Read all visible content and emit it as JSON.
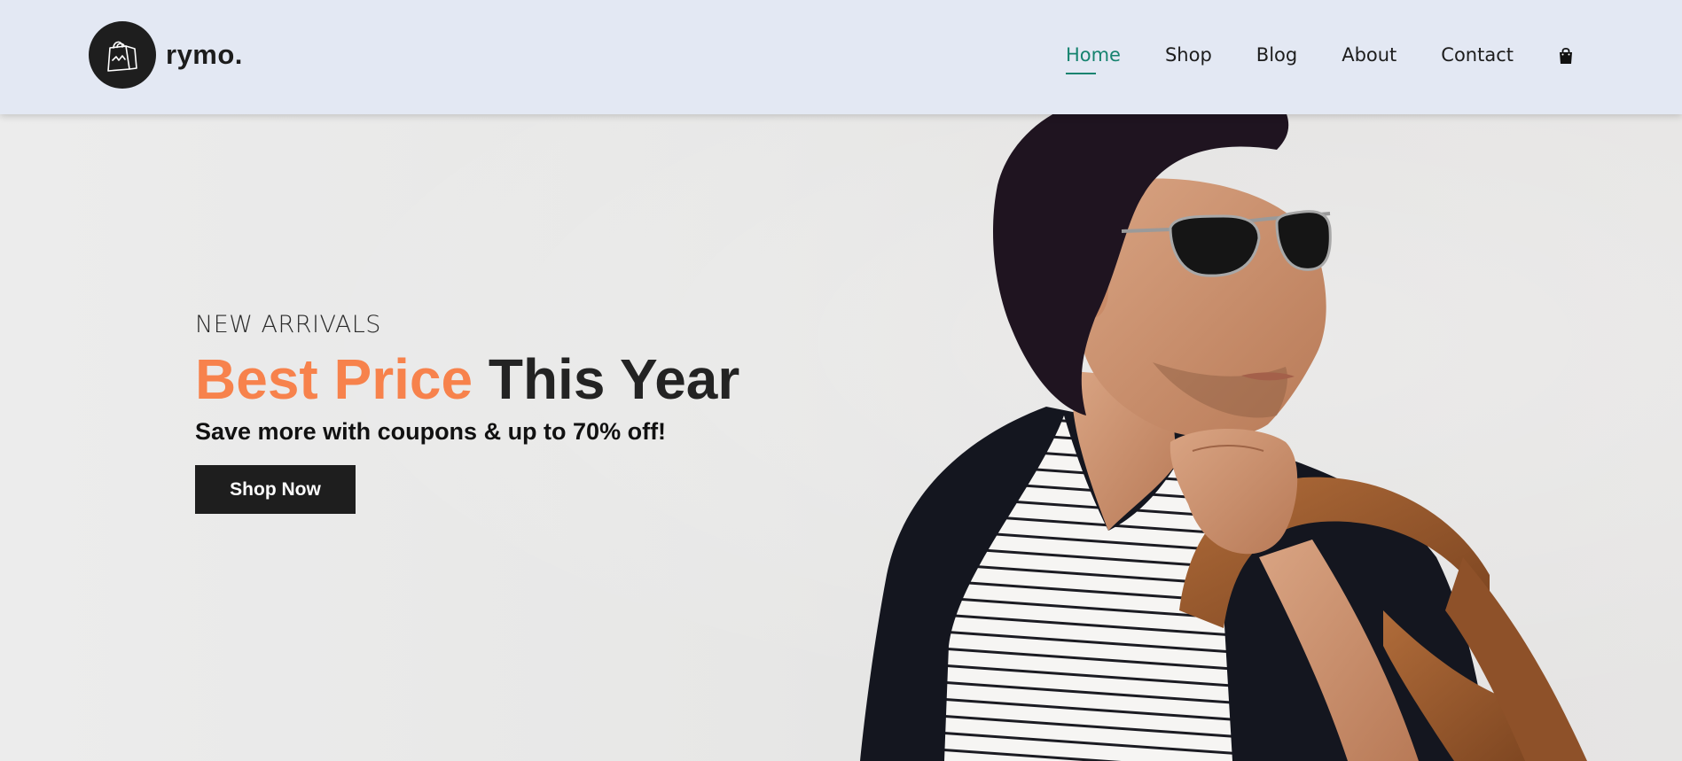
{
  "brand": {
    "name": "rymo.",
    "logo_icon": "shopping-bag-icon"
  },
  "nav": {
    "items": [
      {
        "label": "Home",
        "active": true
      },
      {
        "label": "Shop",
        "active": false
      },
      {
        "label": "Blog",
        "active": false
      },
      {
        "label": "About",
        "active": false
      },
      {
        "label": "Contact",
        "active": false
      }
    ],
    "cart_icon": "cart-bag-icon"
  },
  "hero": {
    "eyebrow": "NEW ARRIVALS",
    "headline_accent": "Best Price",
    "headline_rest": "This Year",
    "subline": "Save more with coupons & up to 70% off!",
    "cta_label": "Shop Now"
  },
  "colors": {
    "header_bg": "#e3e8f3",
    "nav_active": "#16836f",
    "accent_orange": "#f7824c",
    "dark": "#1e1e1e"
  }
}
